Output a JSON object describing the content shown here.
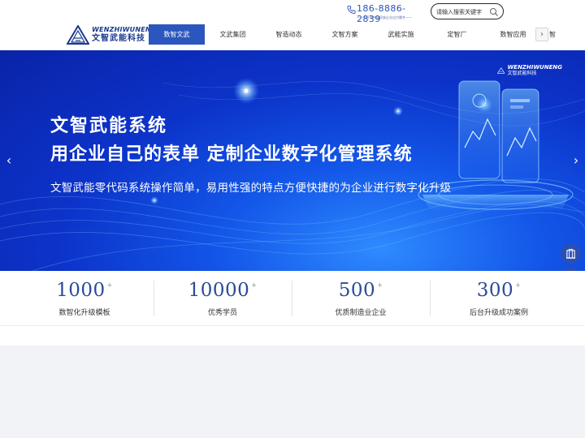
{
  "header": {
    "logo": {
      "en": "WENZHIWUNENG",
      "cn": "文智武能科技"
    },
    "phone": {
      "number": "186-8886-2839",
      "subtitle": "——为开发中国民族企业出力搬冬——"
    },
    "search": {
      "placeholder": "请输入搜索关键字",
      "icon": "search-icon"
    },
    "nav": {
      "items": [
        {
          "label": "数智文武",
          "active": true
        },
        {
          "label": "文武集团",
          "active": false
        },
        {
          "label": "智造动态",
          "active": false
        },
        {
          "label": "文智方案",
          "active": false
        },
        {
          "label": "武能实施",
          "active": false
        },
        {
          "label": "定智厂",
          "active": false
        },
        {
          "label": "数智应用",
          "active": false
        }
      ],
      "more_arrow": "›",
      "overflow_label": "智"
    },
    "accent_color": "#2c56bf"
  },
  "banner": {
    "title_line1": "文智武能系统",
    "title_line2": "用企业自己的表单  定制企业数字化管理系统",
    "description": "文智武能零代码系统操作简单，易用性强的特点方便快捷的为企业进行数字化升级",
    "logo": {
      "en": "WENZHIWUNENG",
      "cn": "文智武能科技"
    },
    "prev_arrow": "‹",
    "next_arrow": "›"
  },
  "side_buttons": [
    {
      "icon": "building-icon"
    },
    {
      "icon": "phone-icon"
    },
    {
      "icon": "qrcode-icon"
    }
  ],
  "stats": [
    {
      "value": "1000",
      "suffix": "+",
      "label": "数智化升级模板"
    },
    {
      "value": "10000",
      "suffix": "+",
      "label": "优秀学员"
    },
    {
      "value": "500",
      "suffix": "+",
      "label": "优质制造业企业"
    },
    {
      "value": "300",
      "suffix": "+",
      "label": "后台升级成功案例"
    }
  ]
}
